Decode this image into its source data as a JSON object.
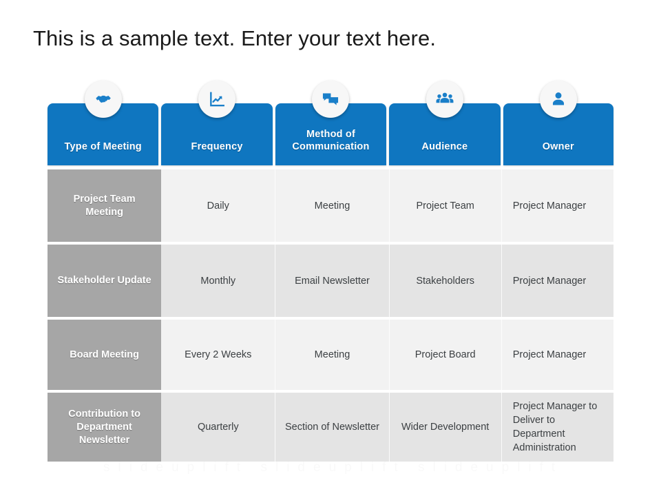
{
  "slide": {
    "title": "This is a sample text. Enter your text here.",
    "watermark": "slideuplift slideuplift slideuplift"
  },
  "colors": {
    "header_blue": "#0f76c0",
    "label_gray": "#a6a6a6",
    "row_light": "#f2f2f2",
    "row_dark": "#e4e4e4",
    "title_text": "#1a1a1a",
    "cell_text": "#3c4043",
    "icon_badge_bg": "#f7f7f7"
  },
  "table": {
    "headers": [
      {
        "label": "Type of Meeting",
        "icon": "handshake-icon"
      },
      {
        "label": "Frequency",
        "icon": "line-chart-icon"
      },
      {
        "label": "Method of Communication",
        "icon": "chat-bubbles-icon"
      },
      {
        "label": "Audience",
        "icon": "people-group-icon"
      },
      {
        "label": "Owner",
        "icon": "person-icon"
      }
    ],
    "rows": [
      {
        "type_of_meeting": "Project Team Meeting",
        "frequency": "Daily",
        "method": "Meeting",
        "audience": "Project Team",
        "owner": "Project Manager"
      },
      {
        "type_of_meeting": "Stakeholder Update",
        "frequency": "Monthly",
        "method": "Email Newsletter",
        "audience": "Stakeholders",
        "owner": "Project Manager"
      },
      {
        "type_of_meeting": "Board Meeting",
        "frequency": "Every 2 Weeks",
        "method": "Meeting",
        "audience": "Project Board",
        "owner": "Project Manager"
      },
      {
        "type_of_meeting": "Contribution to Department Newsletter",
        "frequency": "Quarterly",
        "method": "Section of Newsletter",
        "audience": "Wider Development",
        "owner": "Project Manager to Deliver to Department Administration"
      }
    ]
  }
}
